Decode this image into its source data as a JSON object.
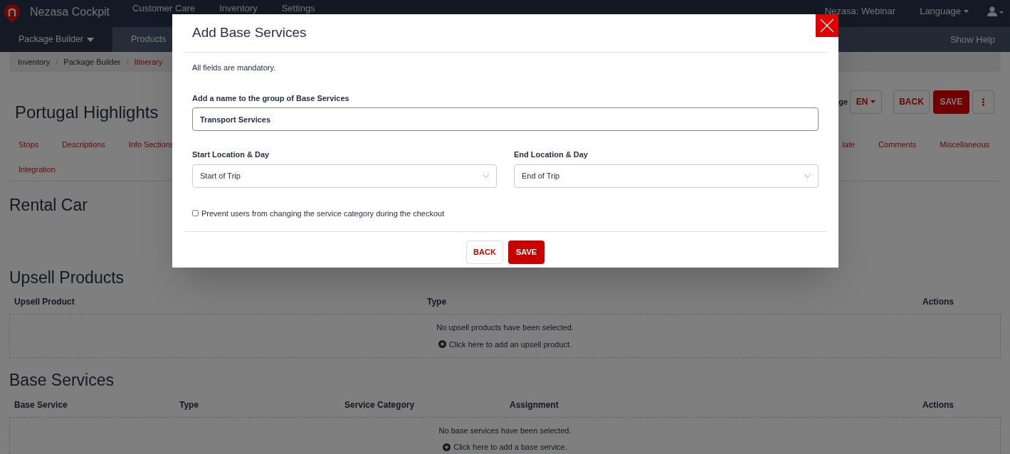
{
  "top_nav": {
    "brand": "Nezasa Cockpit",
    "items": [
      "Customer Care",
      "Inventory",
      "Settings"
    ],
    "account": "Nezasa: Webinar",
    "language": "Language"
  },
  "sub_nav": {
    "items": [
      {
        "label": "Package Builder",
        "dropdown": true,
        "selected": true
      },
      {
        "label": "Products",
        "dropdown": false,
        "selected": false
      }
    ],
    "help": "Show Help"
  },
  "breadcrumb_separator": "/",
  "breadcrumb": [
    {
      "label": "Inventory",
      "current": false
    },
    {
      "label": "Package Builder",
      "current": false
    },
    {
      "label": "Itinerary",
      "current": true
    }
  ],
  "header": {
    "title": "Portugal Highlights",
    "language_label": "ge",
    "language": "EN",
    "back": "BACK",
    "save": "SAVE"
  },
  "tabs": {
    "first_row_left": [
      "Stops",
      "Descriptions",
      "Info Sections"
    ],
    "first_row_right": [
      "late",
      "Comments",
      "Miscellaneous"
    ],
    "second_row": [
      "Integration"
    ]
  },
  "rental_car": {
    "heading": "Rental Car"
  },
  "upsell": {
    "heading": "Upsell Products",
    "columns": [
      "Upsell Product",
      "Type",
      "Actions"
    ],
    "empty_text": "No upsell products have been selected.",
    "add_link": "Click here to add an upsell product."
  },
  "base_services": {
    "heading": "Base Services",
    "columns": [
      "Base Service",
      "Type",
      "Service Category",
      "Assignment",
      "Actions"
    ],
    "empty_text": "No base services have been selected.",
    "add_link": "Click here to add a base service."
  },
  "modal": {
    "title": "Add Base Services",
    "note": "All fields are mandatory.",
    "name_label": "Add a name to the group of Base Services",
    "name_value": "Transport Services",
    "start_label": "Start Location & Day",
    "start_value": "Start of Trip",
    "end_label": "End Location & Day",
    "end_value": "End of Trip",
    "checkbox": {
      "label": "Prevent users from changing the service category during the checkout",
      "checked": false
    },
    "back": "BACK",
    "save": "SAVE"
  }
}
